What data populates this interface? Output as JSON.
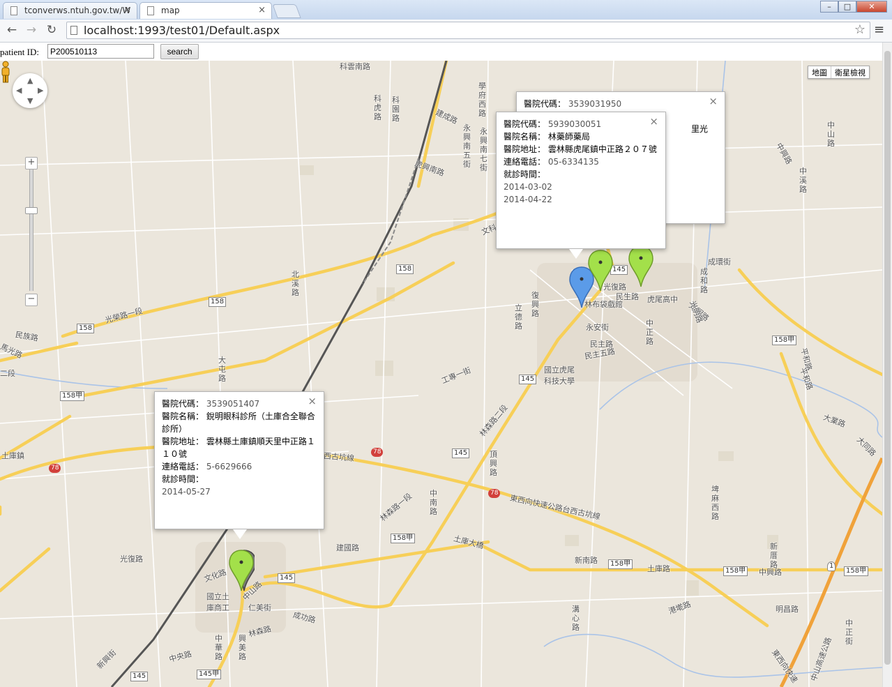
{
  "browser": {
    "tabs": [
      {
        "title": "tconverws.ntuh.gov.tw/W"
      },
      {
        "title": "map"
      }
    ],
    "url": "localhost:1993/test01/Default.aspx",
    "window_controls": [
      "–",
      "□",
      "✕"
    ]
  },
  "form": {
    "label": "patient ID:",
    "patient_id": "P200510113",
    "search_label": "search"
  },
  "map": {
    "type_buttons": [
      "地圖",
      "衛星檢視"
    ],
    "zoom_in": "+",
    "zoom_out": "−",
    "labels": [
      "科雲南路",
      "學府西路",
      "科虎路",
      "科園路",
      "永興南五街",
      "永興南七街",
      "建成路",
      "虎興南路",
      "中山路",
      "中興路",
      "中溪路",
      "北溪路",
      "文科",
      "光榮路一段",
      "民族路",
      "馬光路",
      "二段",
      "大屯路",
      "158甲",
      "土庫鎮",
      "工專一街",
      "立德路",
      "復興路",
      "光復路",
      "林布袋戲館",
      "虎尾高中",
      "民生路",
      "光明路",
      "成環街",
      "永安街",
      "民主路",
      "民主五路",
      "國立虎尾科技大學",
      "林森路二段",
      "頂興路",
      "西古坑線",
      "中南路",
      "建國路",
      "林森路一段",
      "土庫大橋",
      "東西向快速公路台西古坑線",
      "新南路",
      "土庫路",
      "中興路",
      "明昌路",
      "港墘路",
      "溝心路",
      "新厝路",
      "大業路",
      "平和路",
      "文化路",
      "中山路",
      "國立土庫商工",
      "仁美街",
      "成功路",
      "林森路",
      "中央路",
      "中華路",
      "興美路",
      "新興街",
      "光復路",
      "埤麻西路",
      "中正街",
      "中山高速公路",
      "東西向快速",
      "平和路",
      "大同路",
      "光明路",
      "中正路",
      "成和路"
    ],
    "shields": [
      "158",
      "158",
      "158",
      "158甲",
      "145",
      "145",
      "145",
      "78",
      "78",
      "78",
      "145",
      "158甲",
      "158甲",
      "158甲",
      "158甲",
      "145甲",
      "145",
      "1"
    ]
  },
  "info_windows": [
    {
      "rows": [
        {
          "label": "醫院代碼：",
          "value": "3539031950"
        }
      ],
      "partial": "里光"
    },
    {
      "rows": [
        {
          "label": "醫院代碼：",
          "value": "5939030051"
        },
        {
          "label": "醫院名稱：",
          "value": "林藥師藥局"
        },
        {
          "label": "醫院地址：",
          "value": "雲林縣虎尾鎮中正路２０７號"
        },
        {
          "label": "連絡電話：",
          "value": "05-6334135"
        },
        {
          "label": "就診時間：",
          "value": ""
        }
      ],
      "dates": [
        "2014-03-02",
        "2014-04-22"
      ]
    },
    {
      "rows": [
        {
          "label": "醫院代碼：",
          "value": "3539051407"
        },
        {
          "label": "醫院名稱：",
          "value": "銳明眼科診所（土庫合全聯合診所）"
        },
        {
          "label": "醫院地址：",
          "value": "雲林縣土庫鎮順天里中正路１１０號"
        },
        {
          "label": "連絡電話：",
          "value": "5-6629666"
        },
        {
          "label": "就診時間：",
          "value": ""
        }
      ],
      "dates": [
        "2014-05-27"
      ]
    }
  ],
  "markers": [
    {
      "color": "#5b9be8",
      "kind": "blue-marker"
    },
    {
      "color": "#a3e04a",
      "kind": "green-marker"
    },
    {
      "color": "#a3e04a",
      "kind": "green-marker"
    },
    {
      "color": "#a3e04a",
      "kind": "green-marker"
    }
  ]
}
